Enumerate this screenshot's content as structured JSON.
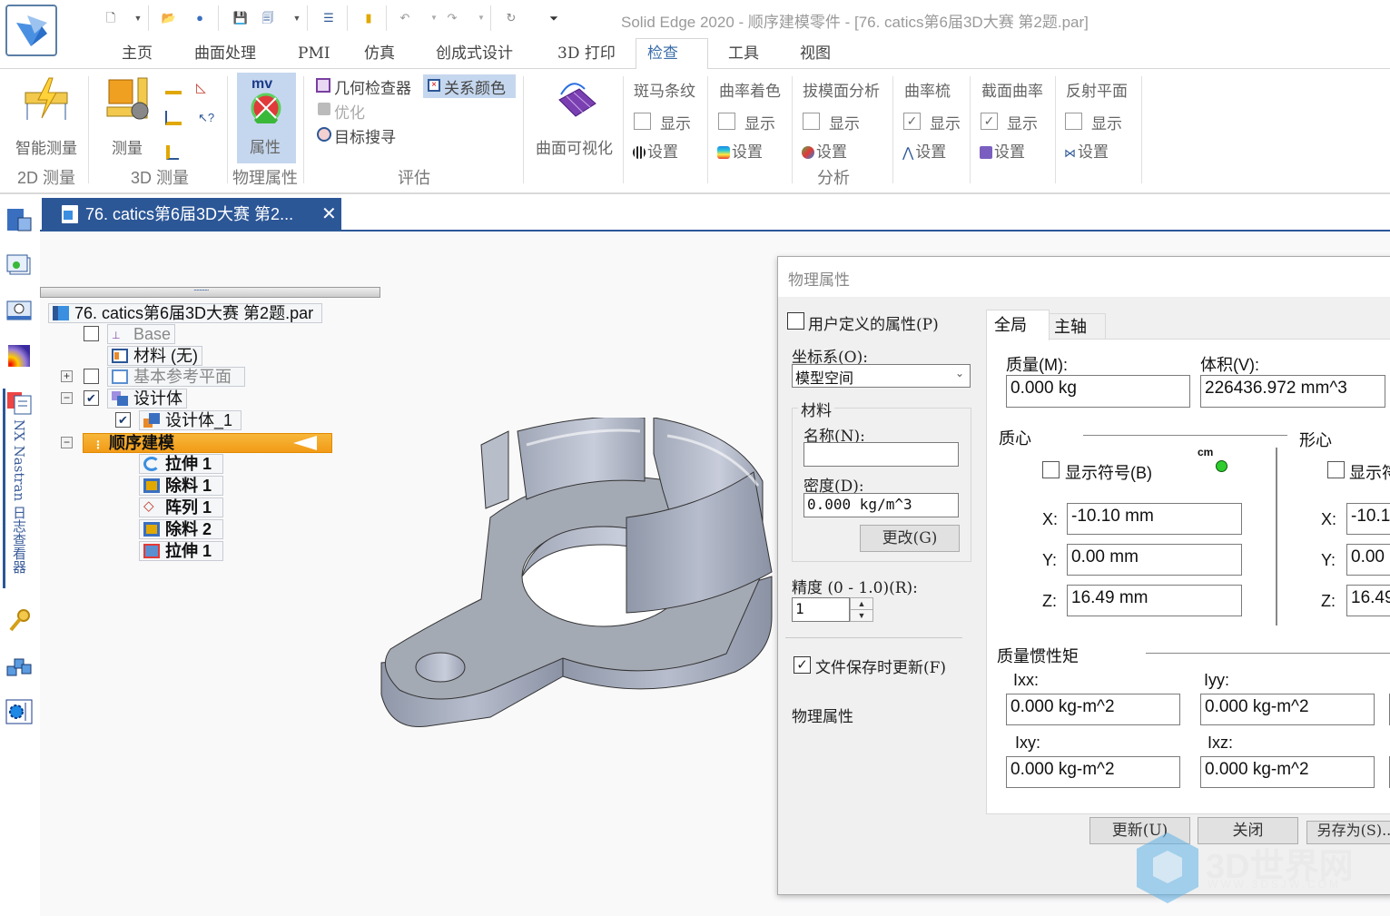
{
  "window_title": "Solid Edge 2020 - 顺序建模零件 - [76. catics第6届3D大赛 第2题.par]",
  "quick_access": [
    "new-icon",
    "new-dropdown",
    "open-icon",
    "find-icon",
    "save-icon",
    "save-as-icon",
    "save-dropdown",
    "properties-icon",
    "exit-icon",
    "undo-icon",
    "undo-dropdown",
    "redo-icon",
    "redo-dropdown",
    "repeat-icon",
    "customize-dropdown"
  ],
  "ribbon_tabs": [
    {
      "label": "主页",
      "active": false
    },
    {
      "label": "曲面处理",
      "active": false
    },
    {
      "label": "PMI",
      "active": false
    },
    {
      "label": "仿真",
      "active": false
    },
    {
      "label": "创成式设计",
      "active": false
    },
    {
      "label": "3D 打印",
      "active": false
    },
    {
      "label": "检查",
      "active": true
    },
    {
      "label": "工具",
      "active": false
    },
    {
      "label": "视图",
      "active": false
    }
  ],
  "ribbon": {
    "smart_measure": "智能测量",
    "group_2d": "2D 测量",
    "measure": "测量",
    "group_3d": "3D 测量",
    "properties": "属性",
    "group_physical": "物理属性",
    "geometry_inspector": "几何检查器",
    "relation_colors": "关系颜色",
    "optimize": "优化",
    "goal_seek": "目标搜寻",
    "group_evaluate": "评估",
    "surface_visualization": "曲面可视化",
    "group_analysis": "分析",
    "analysis_items": [
      {
        "title": "斑马条纹",
        "show": "显示",
        "checked": false,
        "settings": "设置"
      },
      {
        "title": "曲率着色",
        "show": "显示",
        "checked": false,
        "settings": "设置"
      },
      {
        "title": "拔模面分析",
        "show": "显示",
        "checked": false,
        "settings": "设置"
      },
      {
        "title": "曲率梳",
        "show": "显示",
        "checked": true,
        "settings": "设置"
      },
      {
        "title": "截面曲率",
        "show": "显示",
        "checked": true,
        "settings": "设置"
      },
      {
        "title": "反射平面",
        "show": "显示",
        "checked": false,
        "settings": "设置"
      }
    ]
  },
  "left_strip": {
    "nastran_label": "NX Nastran 日志查看器"
  },
  "document_tab": {
    "label": "76. catics第6届3D大赛 第2...",
    "close": "✕"
  },
  "tree": {
    "root": "76. catics第6届3D大赛 第2题.par",
    "items": [
      {
        "label": "Base",
        "checked": false
      },
      {
        "label": "材料 (无)"
      },
      {
        "label": "基本参考平面",
        "checked": false,
        "expander": "+"
      },
      {
        "label": "设计体",
        "checked": true,
        "expander": "−"
      },
      {
        "label": "设计体_1",
        "checked": true
      },
      {
        "label": "顺序建模",
        "expander": "−"
      },
      {
        "label": "拉伸 1"
      },
      {
        "label": "除料 1"
      },
      {
        "label": "阵列 1"
      },
      {
        "label": "除料 2"
      },
      {
        "label": "拉伸 1"
      }
    ]
  },
  "dialog": {
    "title": "物理属性",
    "user_defined": {
      "label": "用户定义的属性(P)",
      "checked": false
    },
    "coord_label": "坐标系(O):",
    "coord_value": "模型空间",
    "material_group": "材料",
    "name_label": "名称(N):",
    "name_value": "",
    "density_label": "密度(D):",
    "density_value": "0.000 kg/m^3",
    "change_button": "更改(G)",
    "accuracy_label": "精度 (0 - 1.0)(R):",
    "accuracy_value": "1",
    "update_on_save": {
      "label": "文件保存时更新(F)",
      "checked": true
    },
    "physical_props_label": "物理属性",
    "tabs": [
      {
        "label": "全局",
        "active": true
      },
      {
        "label": "主轴",
        "active": false
      }
    ],
    "mass_label": "质量(M):",
    "mass_value": "0.000 kg",
    "volume_label": "体积(V):",
    "volume_value": "226436.972 mm^3",
    "center_of_mass": {
      "title": "质心",
      "show_symbol": "显示符号(B)",
      "symbol_checked": false,
      "cm_badge": "cm",
      "x_label": "X:",
      "x": "-10.10 mm",
      "y_label": "Y:",
      "y": "0.00 mm",
      "z_label": "Z:",
      "z": "16.49 mm"
    },
    "centroid": {
      "title": "形心",
      "show_symbol": "显示符",
      "symbol_checked": false,
      "x_label": "X:",
      "x": "-10.1",
      "y_label": "Y:",
      "y": "0.00",
      "z_label": "Z:",
      "z": "16.49"
    },
    "inertia": {
      "title": "质量惯性矩",
      "ixx_label": "Ixx:",
      "ixx": "0.000 kg-m^2",
      "iyy_label": "Iyy:",
      "iyy": "0.000 kg-m^2",
      "ixy_label": "Ixy:",
      "ixy": "0.000 kg-m^2",
      "ixz_label": "Ixz:",
      "ixz": "0.000 kg-m^2"
    },
    "buttons": {
      "update": "更新(U)",
      "close": "关闭",
      "save_as": "另存为(S)..."
    }
  },
  "watermark": {
    "text": "3D世界网",
    "url_text": "WWW.3DSJW.COM"
  },
  "colors": {
    "accent": "#2c5797",
    "active_tab_text": "#3b6ea8",
    "highlight": "#c5d7ee",
    "tree_selected": "#f5a623"
  }
}
